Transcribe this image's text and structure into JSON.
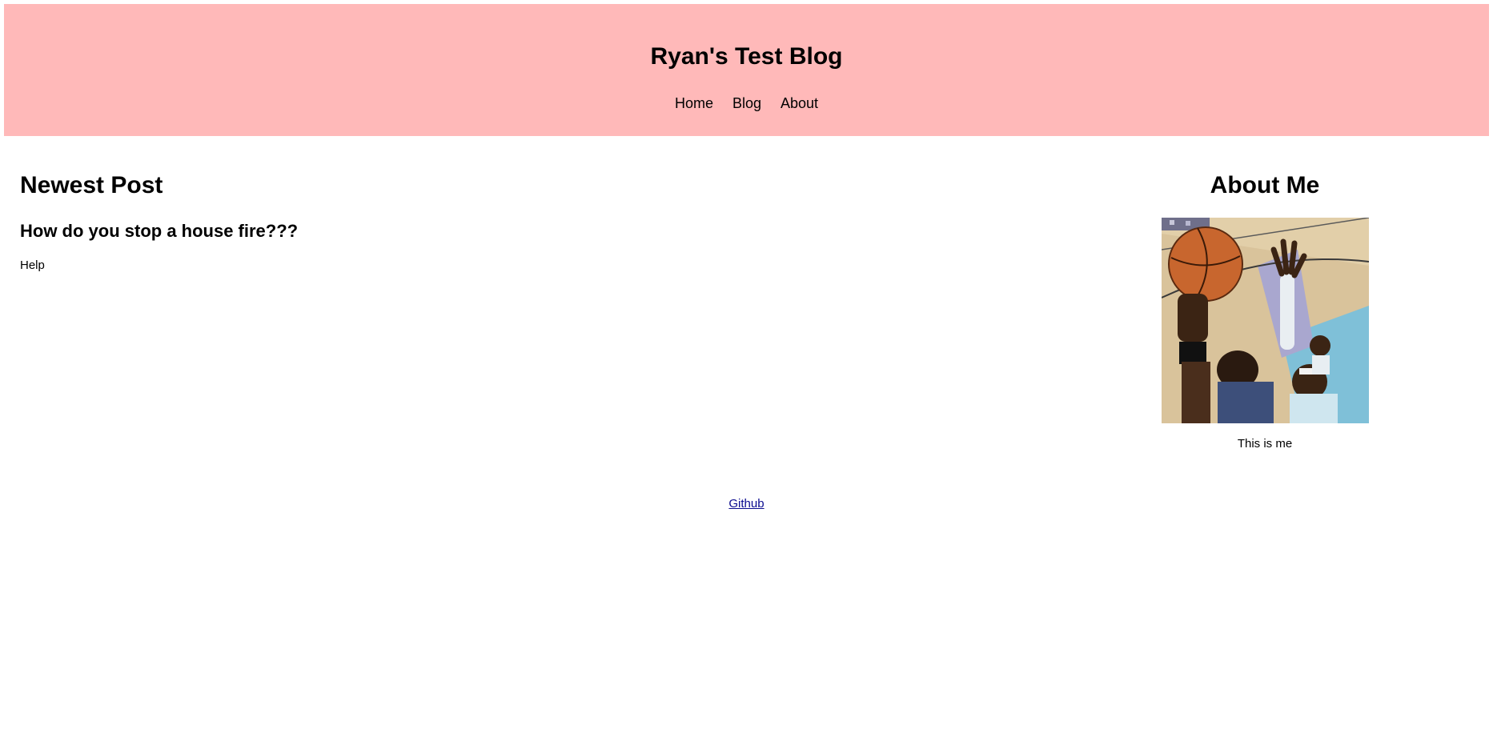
{
  "header": {
    "title": "Ryan's Test Blog",
    "background_color": "#ffb9b9",
    "nav": [
      {
        "label": "Home"
      },
      {
        "label": "Blog"
      },
      {
        "label": "About"
      }
    ]
  },
  "main": {
    "section_heading": "Newest Post",
    "post": {
      "title": "How do you stop a house fire???",
      "body": "Help"
    }
  },
  "aside": {
    "heading": "About Me",
    "photo_icon": "basketball-photo",
    "caption": "This is me"
  },
  "footer": {
    "link_label": "Github",
    "link_color": "#0b0b8f"
  }
}
